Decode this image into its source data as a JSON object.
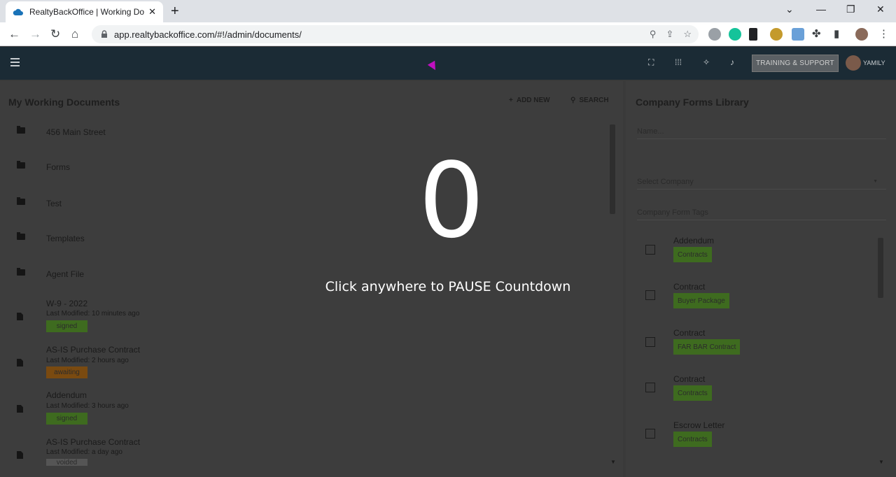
{
  "browser": {
    "tab_title": "RealtyBackOffice | Working Docu",
    "url": "app.realtybackoffice.com/#!/admin/documents/"
  },
  "header": {
    "training_label": "TRAINING & SUPPORT",
    "user_name": "YAMILY"
  },
  "left_panel": {
    "title": "My Working Documents",
    "add_new_label": "ADD NEW",
    "search_label": "SEARCH",
    "folders": [
      "456 Main Street",
      "Forms",
      "Test",
      "Templates",
      "Agent File"
    ],
    "documents": [
      {
        "name": "W-9 - 2022",
        "modified": "Last Modified: 10 minutes ago",
        "status": "signed"
      },
      {
        "name": "AS-IS Purchase Contract",
        "modified": "Last Modified: 2 hours ago",
        "status": "awaiting"
      },
      {
        "name": "Addendum",
        "modified": "Last Modified: 3 hours ago",
        "status": "signed"
      },
      {
        "name": "AS-IS Purchase Contract",
        "modified": "Last Modified: a day ago",
        "status": "voided"
      }
    ]
  },
  "right_panel": {
    "title": "Company Forms Library",
    "name_placeholder": "Name...",
    "select_company_placeholder": "Select Company",
    "tags_placeholder": "Company Form Tags",
    "forms": [
      {
        "name": "Addendum",
        "tag": "Contracts"
      },
      {
        "name": "Contract",
        "tag": "Buyer Package"
      },
      {
        "name": "Contract",
        "tag": "FAR BAR Contract"
      },
      {
        "name": "Contract",
        "tag": "Contracts"
      },
      {
        "name": "Escrow Letter",
        "tag": "Contracts"
      }
    ]
  },
  "overlay": {
    "countdown": "0",
    "message": "Click anywhere to PAUSE Countdown"
  }
}
